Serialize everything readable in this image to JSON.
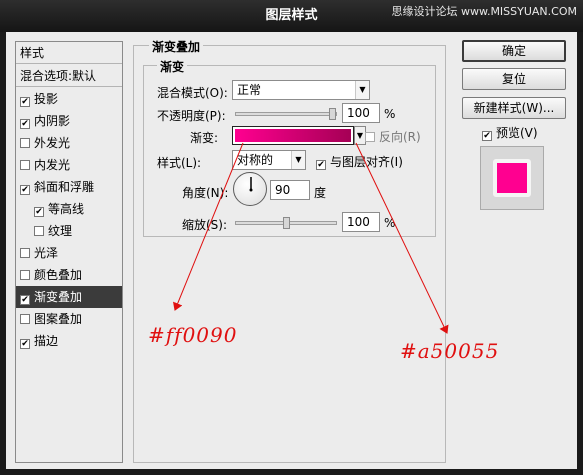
{
  "window": {
    "title": "图层样式",
    "watermark": "思缘设计论坛 www.MISSYUAN.COM"
  },
  "sidebar": {
    "header": "样式",
    "blend_options": "混合选项:默认",
    "items": [
      {
        "label": "投影",
        "checked": true,
        "indent": false
      },
      {
        "label": "内阴影",
        "checked": true,
        "indent": false
      },
      {
        "label": "外发光",
        "checked": false,
        "indent": false
      },
      {
        "label": "内发光",
        "checked": false,
        "indent": false
      },
      {
        "label": "斜面和浮雕",
        "checked": true,
        "indent": false
      },
      {
        "label": "等高线",
        "checked": true,
        "indent": true
      },
      {
        "label": "纹理",
        "checked": false,
        "indent": true
      },
      {
        "label": "光泽",
        "checked": false,
        "indent": false
      },
      {
        "label": "颜色叠加",
        "checked": false,
        "indent": false
      },
      {
        "label": "渐变叠加",
        "checked": true,
        "indent": false,
        "selected": true
      },
      {
        "label": "图案叠加",
        "checked": false,
        "indent": false
      },
      {
        "label": "描边",
        "checked": true,
        "indent": false
      }
    ]
  },
  "panel": {
    "group_title": "渐变叠加",
    "sub_title": "渐变",
    "blend_mode_label": "混合模式(O):",
    "blend_mode_value": "正常",
    "opacity_label": "不透明度(P):",
    "opacity_value": "100",
    "opacity_fraction": 1.0,
    "percent": "%",
    "gradient_label": "渐变:",
    "reverse_label": "反向(R)",
    "reverse_checked": false,
    "style_label": "样式(L):",
    "style_value": "对称的",
    "align_label": "与图层对齐(I)",
    "align_checked": true,
    "angle_label": "角度(N):",
    "angle_value": "90",
    "degree": "度",
    "scale_label": "缩放(S):",
    "scale_value": "100",
    "scale_fraction": 0.5
  },
  "buttons": {
    "ok": "确定",
    "reset": "复位",
    "new_style": "新建样式(W)...",
    "preview_label": "预览(V)",
    "preview_checked": true
  },
  "colors": {
    "gradient_start": "#ff0090",
    "gradient_end": "#a50055",
    "annotation": "#e01010"
  },
  "annotations": {
    "left_color": "#ff0090",
    "right_color": "#a50055"
  }
}
